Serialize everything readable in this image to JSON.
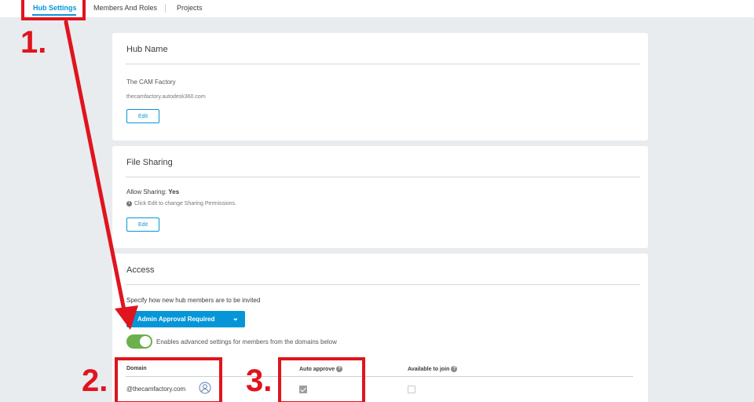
{
  "nav": {
    "tabs": [
      {
        "label": "Hub Settings"
      },
      {
        "label": "Members And Roles"
      },
      {
        "label": "Projects"
      }
    ]
  },
  "hub_name": {
    "title": "Hub Name",
    "name": "The CAM Factory",
    "domain": "thecamfactory.autodesk360.com",
    "edit_label": "Edit"
  },
  "file_sharing": {
    "title": "File Sharing",
    "allow_label": "Allow Sharing:",
    "allow_value": "Yes",
    "info_text": "Click Edit to change Sharing Permissions.",
    "edit_label": "Edit"
  },
  "access": {
    "title": "Access",
    "prompt": "Specify how new hub members are to be invited",
    "dropdown_value": "Admin Approval Required",
    "toggle_on": true,
    "toggle_label": "Enables advanced settings for members from the domains below",
    "columns": {
      "domain": "Domain",
      "auto_approve": "Auto approve",
      "available": "Available to join"
    },
    "rows": [
      {
        "domain": "@thecamfactory.com",
        "auto_approve": true,
        "available": false
      }
    ]
  },
  "annotations": [
    "1.",
    "2.",
    "3."
  ],
  "colors": {
    "accent": "#0696d7",
    "toggle": "#6ab04c",
    "annotation": "#e0141e",
    "background": "#e9ecef"
  }
}
